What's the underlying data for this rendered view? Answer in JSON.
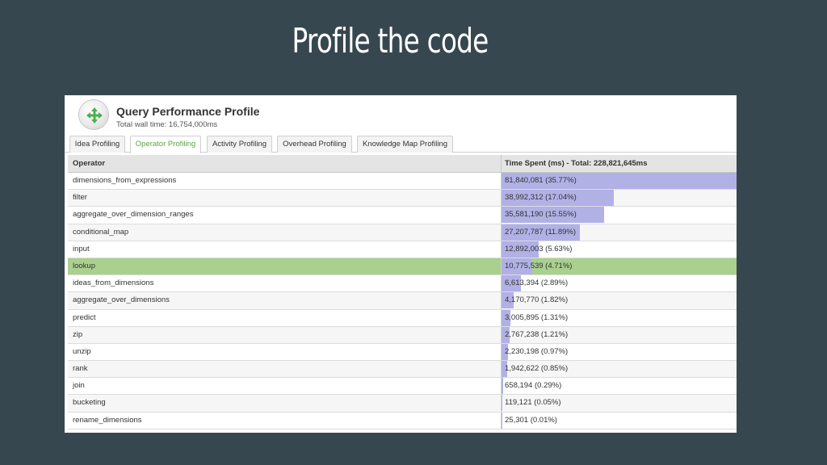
{
  "slide": {
    "title": "Profile the code"
  },
  "header": {
    "icon": "move-arrows-icon",
    "title": "Query Performance Profile",
    "subtitle": "Total wall time: 16,754,000ms"
  },
  "tabs": [
    {
      "label": "Idea Profiling",
      "active": false
    },
    {
      "label": "Operator Profiling",
      "active": true
    },
    {
      "label": "Activity Profiling",
      "active": false
    },
    {
      "label": "Overhead Profiling",
      "active": false
    },
    {
      "label": "Knowledge Map Profiling",
      "active": false
    }
  ],
  "table": {
    "columns": [
      "Operator",
      "Time Spent (ms) - Total: 228,821,645ms"
    ],
    "bar_color": "#b1b1e6",
    "highlight_color": "#a9d08e",
    "rows": [
      {
        "operator": "dimensions_from_expressions",
        "time": "81,840,081 (35.77%)",
        "percent": 35.77
      },
      {
        "operator": "filter",
        "time": "38,992,312 (17.04%)",
        "percent": 17.04
      },
      {
        "operator": "aggregate_over_dimension_ranges",
        "time": "35,581,190 (15.55%)",
        "percent": 15.55
      },
      {
        "operator": "conditional_map",
        "time": "27,207,787 (11.89%)",
        "percent": 11.89
      },
      {
        "operator": "input",
        "time": "12,892,003 (5.63%)",
        "percent": 5.63
      },
      {
        "operator": "lookup",
        "time": "10,775,539 (4.71%)",
        "percent": 4.71,
        "highlighted": true
      },
      {
        "operator": "ideas_from_dimensions",
        "time": "6,613,394 (2.89%)",
        "percent": 2.89
      },
      {
        "operator": "aggregate_over_dimensions",
        "time": "4,170,770 (1.82%)",
        "percent": 1.82
      },
      {
        "operator": "predict",
        "time": "3,005,895 (1.31%)",
        "percent": 1.31
      },
      {
        "operator": "zip",
        "time": "2,767,238 (1.21%)",
        "percent": 1.21
      },
      {
        "operator": "unzip",
        "time": "2,230,198 (0.97%)",
        "percent": 0.97
      },
      {
        "operator": "rank",
        "time": "1,942,622 (0.85%)",
        "percent": 0.85
      },
      {
        "operator": "join",
        "time": "658,194 (0.29%)",
        "percent": 0.29
      },
      {
        "operator": "bucketing",
        "time": "119,121 (0.05%)",
        "percent": 0.05
      },
      {
        "operator": "rename_dimensions",
        "time": "25,301 (0.01%)",
        "percent": 0.01
      }
    ]
  }
}
